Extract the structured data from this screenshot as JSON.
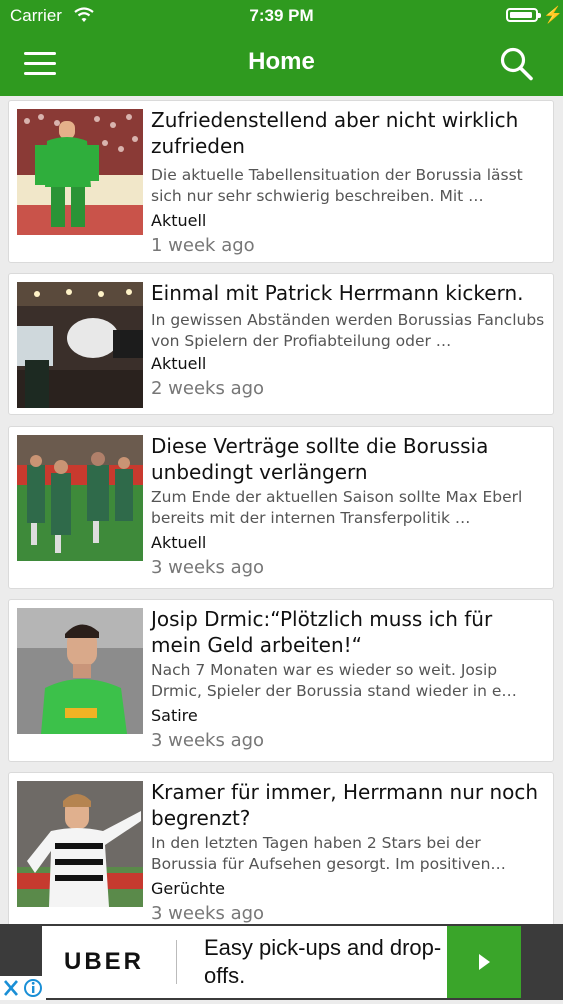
{
  "status_bar": {
    "carrier": "Carrier",
    "time": "7:39 PM"
  },
  "navbar": {
    "title": "Home",
    "left_icon": "menu-icon",
    "right_icon": "search-icon"
  },
  "colors": {
    "brand_green": "#2f9a1f",
    "ad_cta_green": "#3aa52a"
  },
  "articles": [
    {
      "headline": "Zufriedenstellend aber nicht wirklich zufrieden",
      "summary": "Die aktuelle Tabellensituation der Borussia lässt sich nur sehr schwierig beschreiben. Mit …",
      "category": "Aktuell",
      "age": "1 week ago"
    },
    {
      "headline": "Einmal mit Patrick Herrmann kickern.",
      "summary": "In gewissen Abständen werden Borussias Fanclubs von Spielern der Profiabteilung oder …",
      "category": "Aktuell",
      "age": "2 weeks ago"
    },
    {
      "headline": "Diese Verträge sollte die Borussia unbedingt verlängern",
      "summary": "Zum Ende der aktuellen Saison sollte Max Eberl bereits mit der internen Transferpolitik …",
      "category": "Aktuell",
      "age": "3 weeks ago"
    },
    {
      "headline": "Josip Drmic:“Plötzlich muss ich für mein Geld arbeiten!“",
      "summary": "Nach 7 Monaten war es wieder so weit. Josip Drmic, Spieler der Borussia stand wieder in e…",
      "category": "Satire",
      "age": "3 weeks ago"
    },
    {
      "headline": "Kramer für immer, Herrmann nur noch begrenzt?",
      "summary": "In den letzten Tagen haben 2 Stars bei der Borussia für Aufsehen gesorgt. Im positiven…",
      "category": "Gerüchte",
      "age": "3 weeks ago"
    }
  ],
  "ad": {
    "brand": "UBER",
    "tagline": "Easy pick-ups and drop-offs."
  }
}
